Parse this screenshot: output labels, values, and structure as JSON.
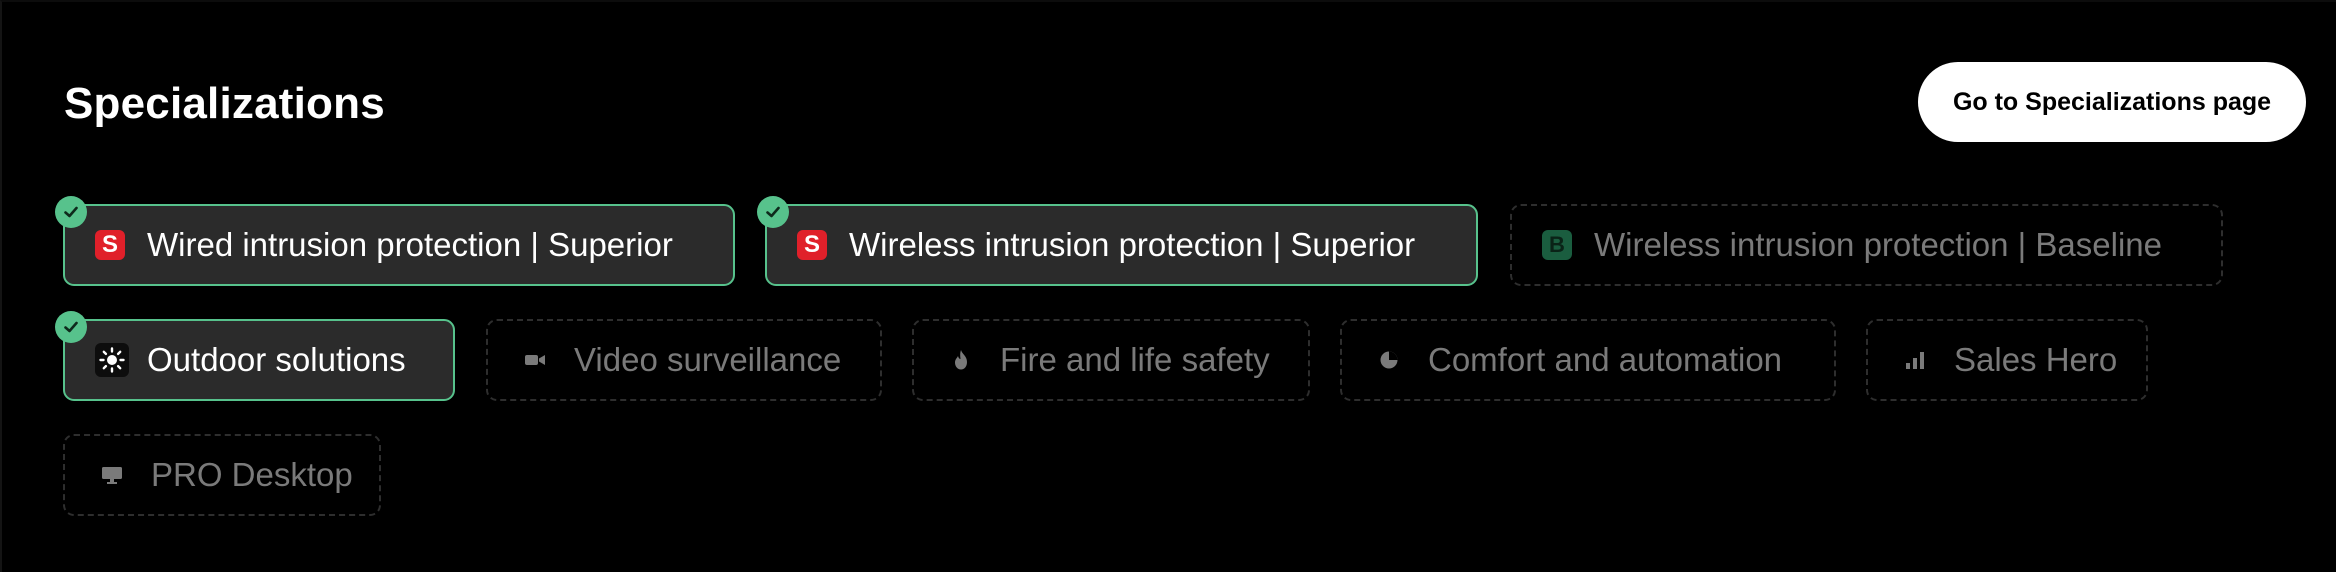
{
  "section": {
    "title": "Specializations",
    "goto_label": "Go to Specializations page"
  },
  "chips": [
    {
      "label": "Wired intrusion protection | Superior",
      "icon": "red-s-badge-icon",
      "achieved": true
    },
    {
      "label": "Wireless intrusion protection | Superior",
      "icon": "red-s-badge-icon",
      "achieved": true
    },
    {
      "label": "Wireless intrusion protection | Baseline",
      "icon": "green-b-badge-icon",
      "achieved": false
    },
    {
      "label": "Outdoor solutions",
      "icon": "sun-icon",
      "achieved": true
    },
    {
      "label": "Video surveillance",
      "icon": "video-camera-icon",
      "achieved": false
    },
    {
      "label": "Fire and life safety",
      "icon": "flame-icon",
      "achieved": false
    },
    {
      "label": "Comfort and automation",
      "icon": "pie-chart-icon",
      "achieved": false
    },
    {
      "label": "Sales Hero",
      "icon": "bar-chart-icon",
      "achieved": false
    },
    {
      "label": "PRO Desktop",
      "icon": "monitor-icon",
      "achieved": false
    }
  ],
  "badge_letters": {
    "superior": "S",
    "baseline": "B"
  },
  "colors": {
    "background": "#000000",
    "accent_green": "#57c28c",
    "active_chip_bg": "#2b2b2b",
    "inactive_text": "#7a7a7a",
    "superior_red": "#e0202a",
    "baseline_green": "#1f6e4b",
    "button_bg": "#ffffff"
  }
}
